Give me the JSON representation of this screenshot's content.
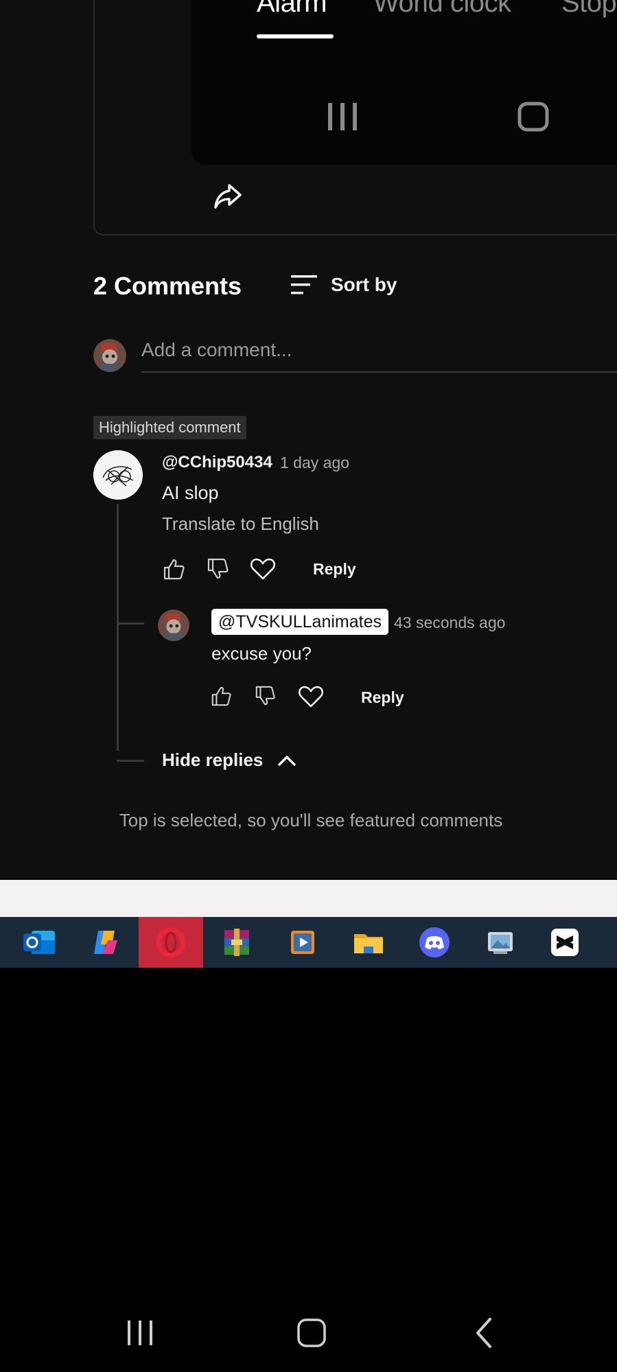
{
  "video": {
    "clock_tabs": [
      "Alarm",
      "World clock",
      "Stop"
    ],
    "active_tab": "Alarm"
  },
  "comments": {
    "count_label": "2 Comments",
    "sort_label": "Sort by",
    "add_placeholder": "Add a comment...",
    "highlight_badge": "Highlighted comment",
    "thread": {
      "author": "@CChip50434",
      "time": "1 day ago",
      "text": "AI slop",
      "translate": "Translate to English",
      "reply_label": "Reply"
    },
    "reply": {
      "author": "@TVSKULLanimates",
      "time": "43 seconds ago",
      "text": "excuse you?",
      "reply_label": "Reply"
    },
    "hide_replies": "Hide replies",
    "footer_note": "Top is selected, so you'll see featured comments"
  },
  "taskbar": {
    "icons": [
      "outlook-icon",
      "copilot-icon",
      "opera-icon",
      "winrar-icon",
      "media-player-icon",
      "file-explorer-icon",
      "discord-icon",
      "photos-icon",
      "capcut-icon"
    ],
    "active": "opera-icon"
  },
  "system_nav": [
    "recent-apps-icon",
    "home-icon",
    "back-icon"
  ],
  "colors": {
    "background": "#0f0f0f",
    "taskbar": "#1b2a3b",
    "taskbar_active": "#c5283b"
  }
}
